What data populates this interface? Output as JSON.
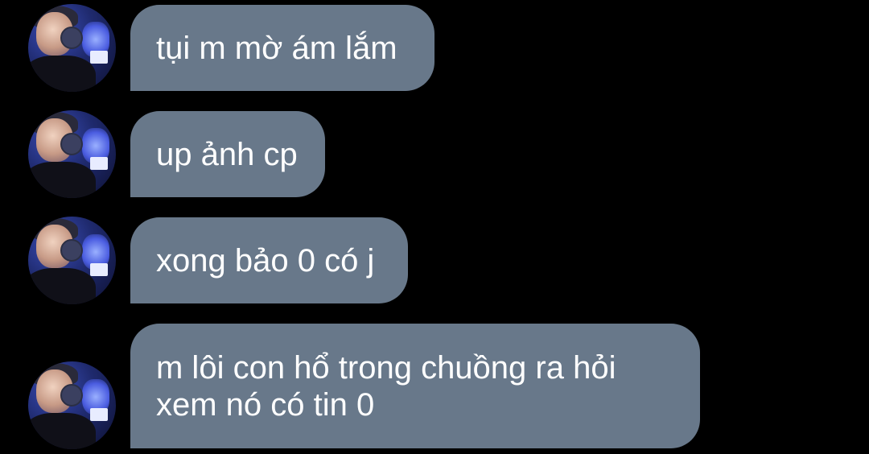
{
  "messages": [
    {
      "text": "tụi m mờ ám lắm"
    },
    {
      "text": "up ảnh cp"
    },
    {
      "text": "xong bảo 0 có j"
    },
    {
      "text": "m lôi con hổ trong chuồng ra hỏi\nxem nó có tin 0"
    }
  ],
  "colors": {
    "background": "#000000",
    "bubble": "#68788a",
    "text": "#ffffff"
  }
}
